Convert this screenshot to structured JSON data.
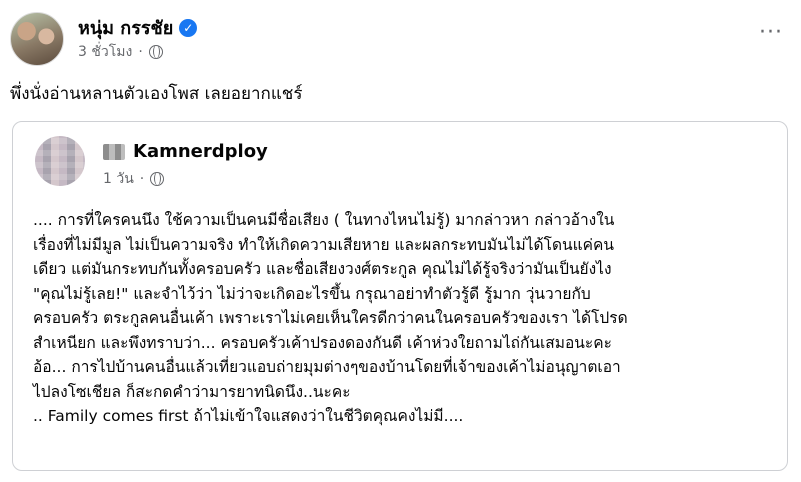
{
  "post": {
    "author_name": "หนุ่ม กรรชัย",
    "verified_mark": "✓",
    "time": "3 ชั่วโมง",
    "separator": "·",
    "more_label": "···",
    "text": "พึ่งนั่งอ่านหลานตัวเองโพส เลยอยากแชร์"
  },
  "shared_post": {
    "author_name": "Kamnerdploy",
    "time": "1 วัน",
    "separator": "·",
    "lines": [
      ".... การที่ใครคนนึง ใช้ความเป็นคนมีชื่อเสียง ( ในทางไหนไม่รู้) มากล่าวหา กล่าวอ้างใน",
      "เรื่องที่ไม่มีมูล ไม่เป็นความจริง ทำให้เกิดความเสียหาย และผลกระทบมันไม่ได้โดนแค่คน",
      "เดียว แต่มันกระทบกันทั้งครอบครัว และชื่อเสียงวงศ์ตระกูล คุณไม่ได้รู้จริงว่ามันเป็นยังไง",
      "\"คุณไม่รู้เลย!\" และจำไว้ว่า ไม่ว่าจะเกิดอะไรขึ้น กรุณาอย่าทำตัวรู้ดี รู้มาก วุ่นวายกับ",
      "ครอบครัว ตระกูลคนอื่นเค้า เพราะเราไม่เคยเห็นใครดีกว่าคนในครอบครัวของเรา ได้โปรด",
      "สำเหนียก และพึงทราบว่า... ครอบครัวเค้าปรองดองกันดี เค้าห่วงใยถามไถ่กันเสมอนะคะ",
      "อ้อ... การไปบ้านคนอื่นแล้วเที่ยวแอบถ่ายมุมต่างๆของบ้านโดยที่เจ้าของเค้าไม่อนุญาตเอา",
      "ไปลงโซเชียล ก็สะกดคำว่ามารยาทนิดนึง..นะคะ",
      ".. Family comes first ถ้าไม่เข้าใจแสดงว่าในชีวิตคุณคงไม่มี...."
    ]
  },
  "icons": {
    "avatar": "profile-photo",
    "verified": "verified-badge-icon",
    "audience": "globe-icon",
    "more": "more-options-icon"
  },
  "colors": {
    "text": "#050505",
    "secondary": "#65676b",
    "verified": "#1877f2",
    "card_border": "#ced0d4"
  }
}
